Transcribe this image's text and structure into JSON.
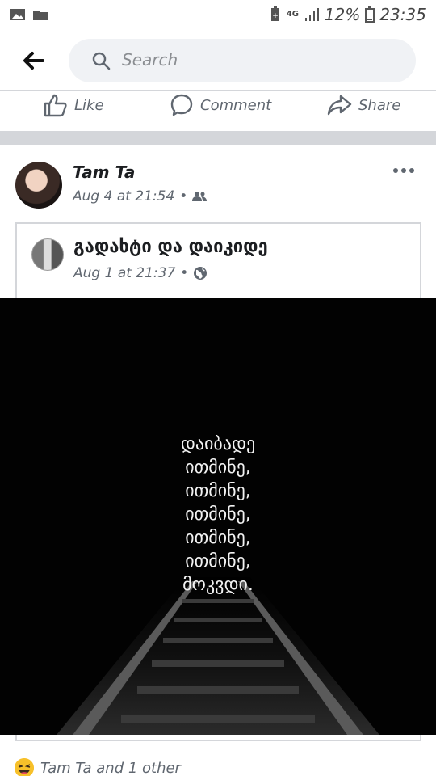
{
  "status_bar": {
    "network": "4G",
    "battery_percent": "12%",
    "time": "23:35",
    "icons": [
      "image-icon",
      "folder-icon",
      "battery-saver-icon",
      "signal-icon",
      "battery-icon"
    ]
  },
  "header": {
    "search_placeholder": "Search",
    "back_icon": "back-arrow-icon",
    "search_icon": "search-icon"
  },
  "action_bar": {
    "like_label": "Like",
    "comment_label": "Comment",
    "share_label": "Share"
  },
  "post": {
    "author": "Tam Ta",
    "timestamp": "Aug 4 at 21:54",
    "audience_icon": "friends-icon",
    "shared_post": {
      "page_name": "გადახტი და დაიკიდე",
      "timestamp": "Aug 1 at 21:37",
      "audience_icon": "globe-icon",
      "image_text": [
        "დაიბადე",
        "ითმინე,",
        "ითმინე,",
        "ითმინე,",
        "ითმინე,",
        "ითმინე,",
        "მოკვდი."
      ]
    },
    "reactions": {
      "text": "Tam Ta and 1 other",
      "emoji": "laughing-emoji"
    }
  },
  "colors": {
    "accent_text": "#606770",
    "divider": "#d4d6da",
    "search_bg": "#f0f2f5",
    "photo_bg": "#020202",
    "reaction_yellow": "#f7c02a"
  }
}
